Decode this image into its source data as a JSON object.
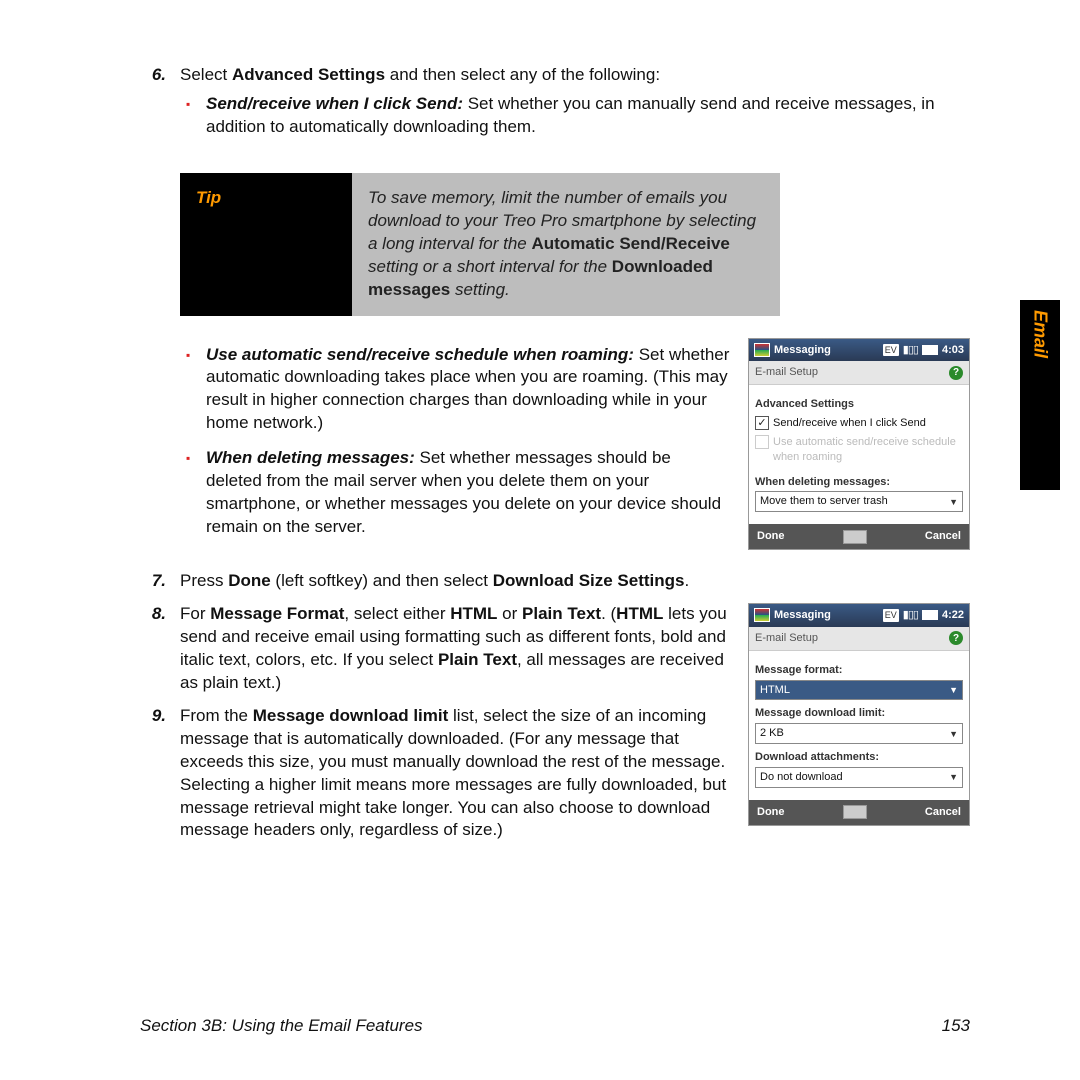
{
  "sideTab": "Email",
  "step6": {
    "num": "6.",
    "lead_a": "Select ",
    "lead_b": "Advanced Settings",
    "lead_c": " and then select any of the following:",
    "sr_title": "Send/receive when I click Send:",
    "sr_body": " Set whether you can manually send and receive messages, in addition to automatically downloading them.",
    "roam_title": "Use automatic send/receive schedule when roaming:",
    "roam_body": " Set whether automatic downloading takes place when you are roaming. (This may result in higher connection charges than downloading while in your home network.)",
    "del_title": "When deleting messages:",
    "del_body": " Set whether messages should be deleted from the mail server when you delete them on your smartphone, or whether messages you delete on your device should remain on the server."
  },
  "tip": {
    "label": "Tip",
    "t1": "To save memory, limit the number of emails you download to your Treo Pro smartphone by selecting a long interval for the ",
    "b1": "Automatic Send/Receive",
    "t2": " setting or a short interval for the ",
    "b2": "Downloaded messages",
    "t3": " setting."
  },
  "step7": {
    "num": "7.",
    "a": "Press ",
    "b": "Done",
    "c": " (left softkey) and then select ",
    "d": "Download Size Settings",
    "e": "."
  },
  "step8": {
    "num": "8.",
    "a": "For ",
    "b": "Message Format",
    "c": ", select either ",
    "d": "HTML",
    "e": " or ",
    "f": "Plain Text",
    "g": ". (",
    "h": "HTML",
    "i": " lets you send and receive email using formatting such as different fonts, bold and italic text, colors, etc. If you select ",
    "j": "Plain Text",
    "k": ", all messages are received as plain text.)"
  },
  "step9": {
    "num": "9.",
    "a": "From the ",
    "b": "Message download limit",
    "c": " list, select the size of an incoming message that is automatically downloaded. (For any message that exceeds this size, you must manually download the rest of the message. Selecting a higher limit means more messages are fully downloaded, but message retrieval might take longer. You can also choose to download message headers only, regardless of size.)"
  },
  "ss1": {
    "title": "Messaging",
    "ev": "EV",
    "time": "4:03",
    "header": "E-mail Setup",
    "adv": "Advanced Settings",
    "c1": "Send/receive when I click Send",
    "c2": "Use automatic send/receive schedule when roaming",
    "wdm": "When deleting messages:",
    "opt": "Move them to server trash",
    "done": "Done",
    "cancel": "Cancel"
  },
  "ss2": {
    "title": "Messaging",
    "ev": "EV",
    "time": "4:22",
    "header": "E-mail Setup",
    "mf": "Message format:",
    "mfv": "HTML",
    "mdl": "Message download limit:",
    "mdlv": "2 KB",
    "da": "Download attachments:",
    "dav": "Do not download",
    "done": "Done",
    "cancel": "Cancel"
  },
  "footer": {
    "section": "Section 3B: Using the Email Features",
    "page": "153"
  }
}
